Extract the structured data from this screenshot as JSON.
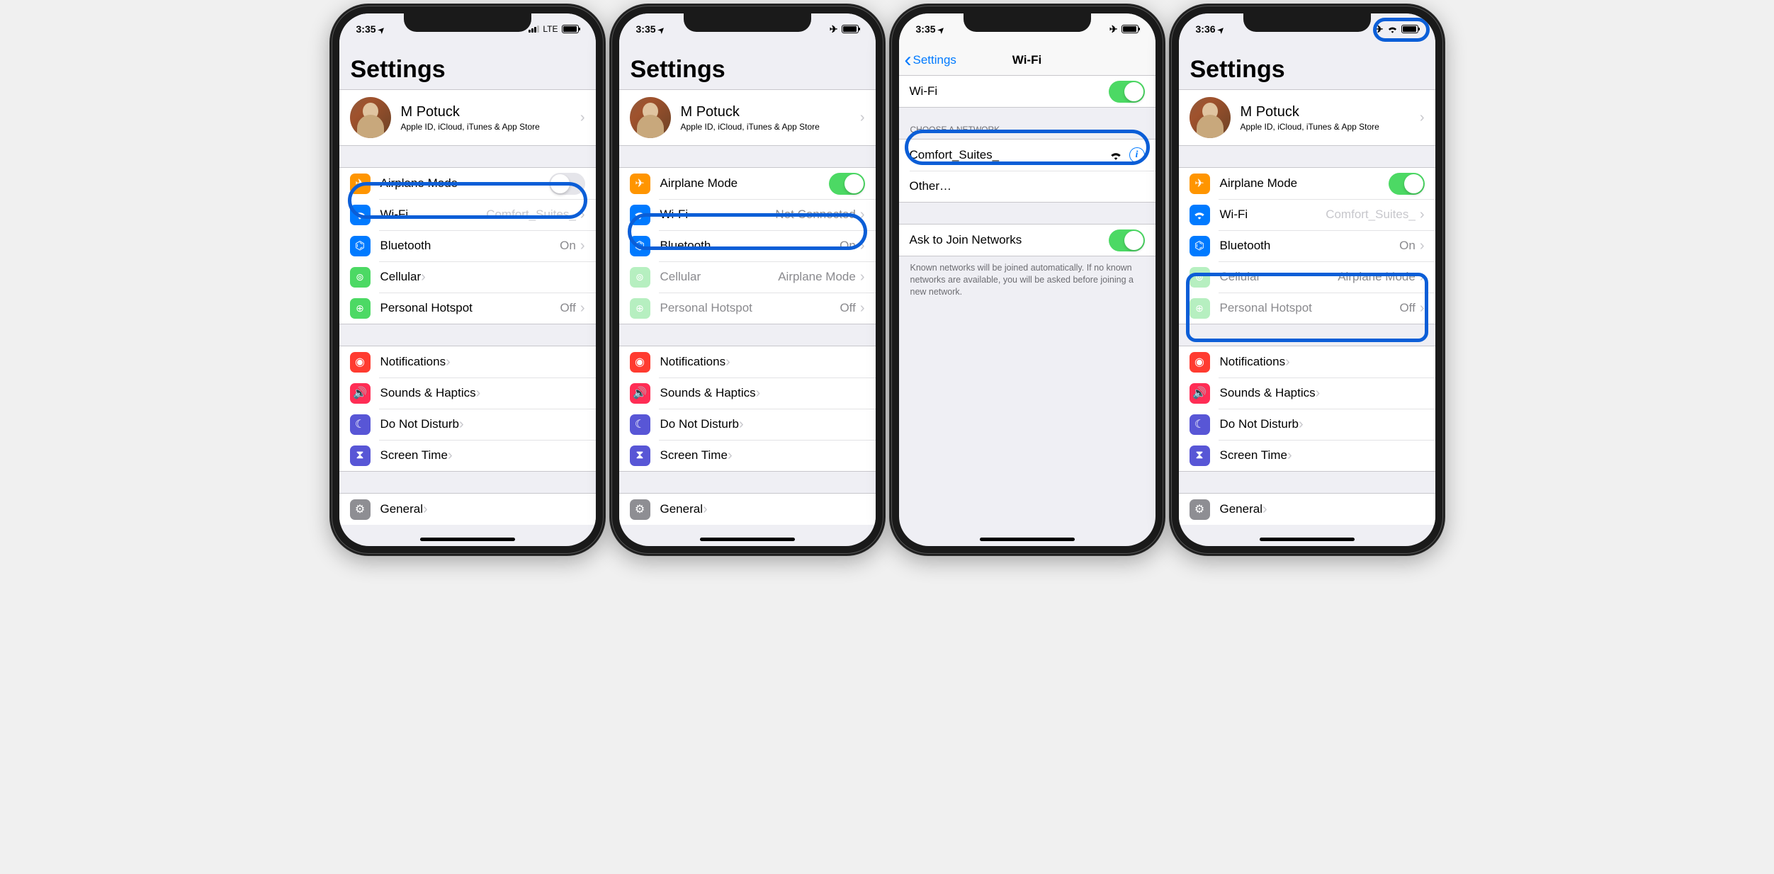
{
  "screens": [
    {
      "time": "3:35",
      "carrier": "LTE",
      "title": "Settings",
      "user": {
        "name": "M Potuck",
        "sub": "Apple ID, iCloud, iTunes & App Store"
      },
      "rows": {
        "airplane": "Airplane Mode",
        "wifi": "Wi-Fi",
        "wifi_value": "Comfort_Suites_",
        "bluetooth": "Bluetooth",
        "bt_value": "On",
        "cellular": "Cellular",
        "hotspot": "Personal Hotspot",
        "hotspot_value": "Off",
        "notifications": "Notifications",
        "sounds": "Sounds & Haptics",
        "dnd": "Do Not Disturb",
        "screentime": "Screen Time",
        "general": "General"
      }
    },
    {
      "time": "3:35",
      "title": "Settings",
      "user": {
        "name": "M Potuck",
        "sub": "Apple ID, iCloud, iTunes & App Store"
      },
      "rows": {
        "airplane": "Airplane Mode",
        "wifi": "Wi-Fi",
        "wifi_value": "Not Connected",
        "bluetooth": "Bluetooth",
        "bt_value": "On",
        "cellular": "Cellular",
        "cellular_value": "Airplane Mode",
        "hotspot": "Personal Hotspot",
        "hotspot_value": "Off",
        "notifications": "Notifications",
        "sounds": "Sounds & Haptics",
        "dnd": "Do Not Disturb",
        "screentime": "Screen Time",
        "general": "General"
      }
    },
    {
      "time": "3:35",
      "back": "Settings",
      "title": "Wi-Fi",
      "wifi_label": "Wi-Fi",
      "choose_header": "CHOOSE A NETWORK…",
      "network": "Comfort_Suites_",
      "other": "Other…",
      "ask_join": "Ask to Join Networks",
      "footer": "Known networks will be joined automatically. If no known networks are available, you will be asked before joining a new network."
    },
    {
      "time": "3:36",
      "title": "Settings",
      "user": {
        "name": "M Potuck",
        "sub": "Apple ID, iCloud, iTunes & App Store"
      },
      "rows": {
        "airplane": "Airplane Mode",
        "wifi": "Wi-Fi",
        "wifi_value": "Comfort_Suites_",
        "bluetooth": "Bluetooth",
        "bt_value": "On",
        "cellular": "Cellular",
        "cellular_value": "Airplane Mode",
        "hotspot": "Personal Hotspot",
        "hotspot_value": "Off",
        "notifications": "Notifications",
        "sounds": "Sounds & Haptics",
        "dnd": "Do Not Disturb",
        "screentime": "Screen Time",
        "general": "General"
      }
    }
  ]
}
